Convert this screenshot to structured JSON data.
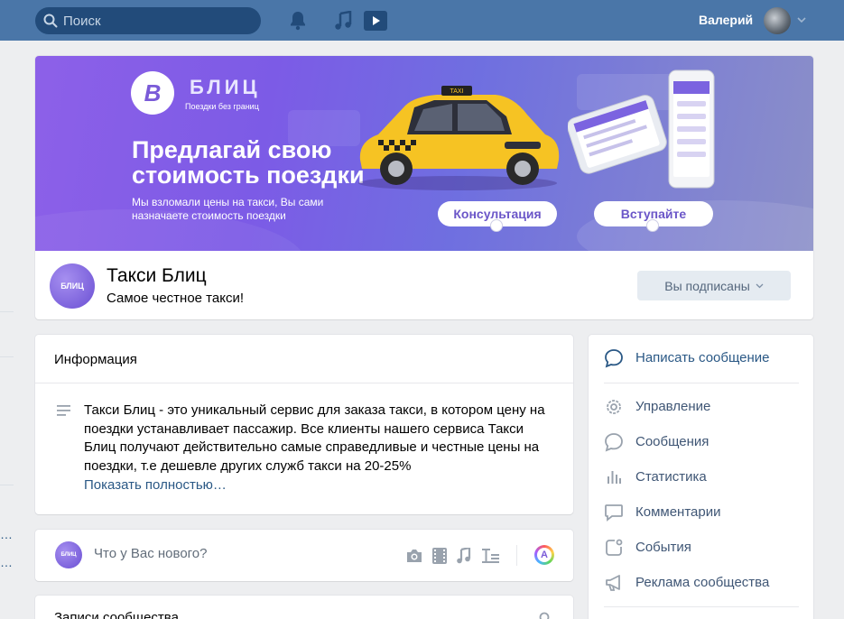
{
  "topbar": {
    "search_placeholder": "Поиск",
    "username": "Валерий",
    "icons": [
      "search-icon",
      "bell-icon",
      "music-icon",
      "video-icon",
      "chevron-down-icon"
    ]
  },
  "cover": {
    "brand": "БЛИЦ",
    "tagline": "Поездки без границ",
    "headline": "Предлагай свою стоимость поездки",
    "subtext": "Мы взломали цены на такси, Вы сами назначаете стоимость поездки",
    "button_consult": "Консультация",
    "button_join": "Вступайте",
    "car_sign": "TAXI"
  },
  "group": {
    "avatar_text": "БЛИЦ",
    "name": "Такси Блиц",
    "status": "Самое честное такси!",
    "subscribe_label": "Вы подписаны"
  },
  "info": {
    "title": "Информация",
    "text": "Такси Блиц - это уникальный сервис для заказа такси, в котором цену на поездки устанавливает пассажир. Все клиенты нашего сервиса Такси Блиц получают действительно самые справедливые и честные цены на поездки, т.е дешевле других служб такси на 20-25%",
    "more": "Показать полностью…"
  },
  "post": {
    "avatar_text": "БЛИЦ",
    "placeholder": "Что у Вас нового?"
  },
  "wall": {
    "title": "Записи сообщества"
  },
  "menu": {
    "write_message": "Написать сообщение",
    "items": [
      {
        "label": "Управление",
        "icon": "gear-icon"
      },
      {
        "label": "Сообщения",
        "icon": "message-icon"
      },
      {
        "label": "Статистика",
        "icon": "stats-icon"
      },
      {
        "label": "Комментарии",
        "icon": "comment-icon"
      },
      {
        "label": "События",
        "icon": "events-icon"
      },
      {
        "label": "Реклама сообщества",
        "icon": "megaphone-icon"
      }
    ]
  },
  "colors": {
    "topbar": "#4a76a8",
    "link": "#2a5885",
    "background": "#edeef0",
    "cover_purple": "#7c5be6"
  }
}
